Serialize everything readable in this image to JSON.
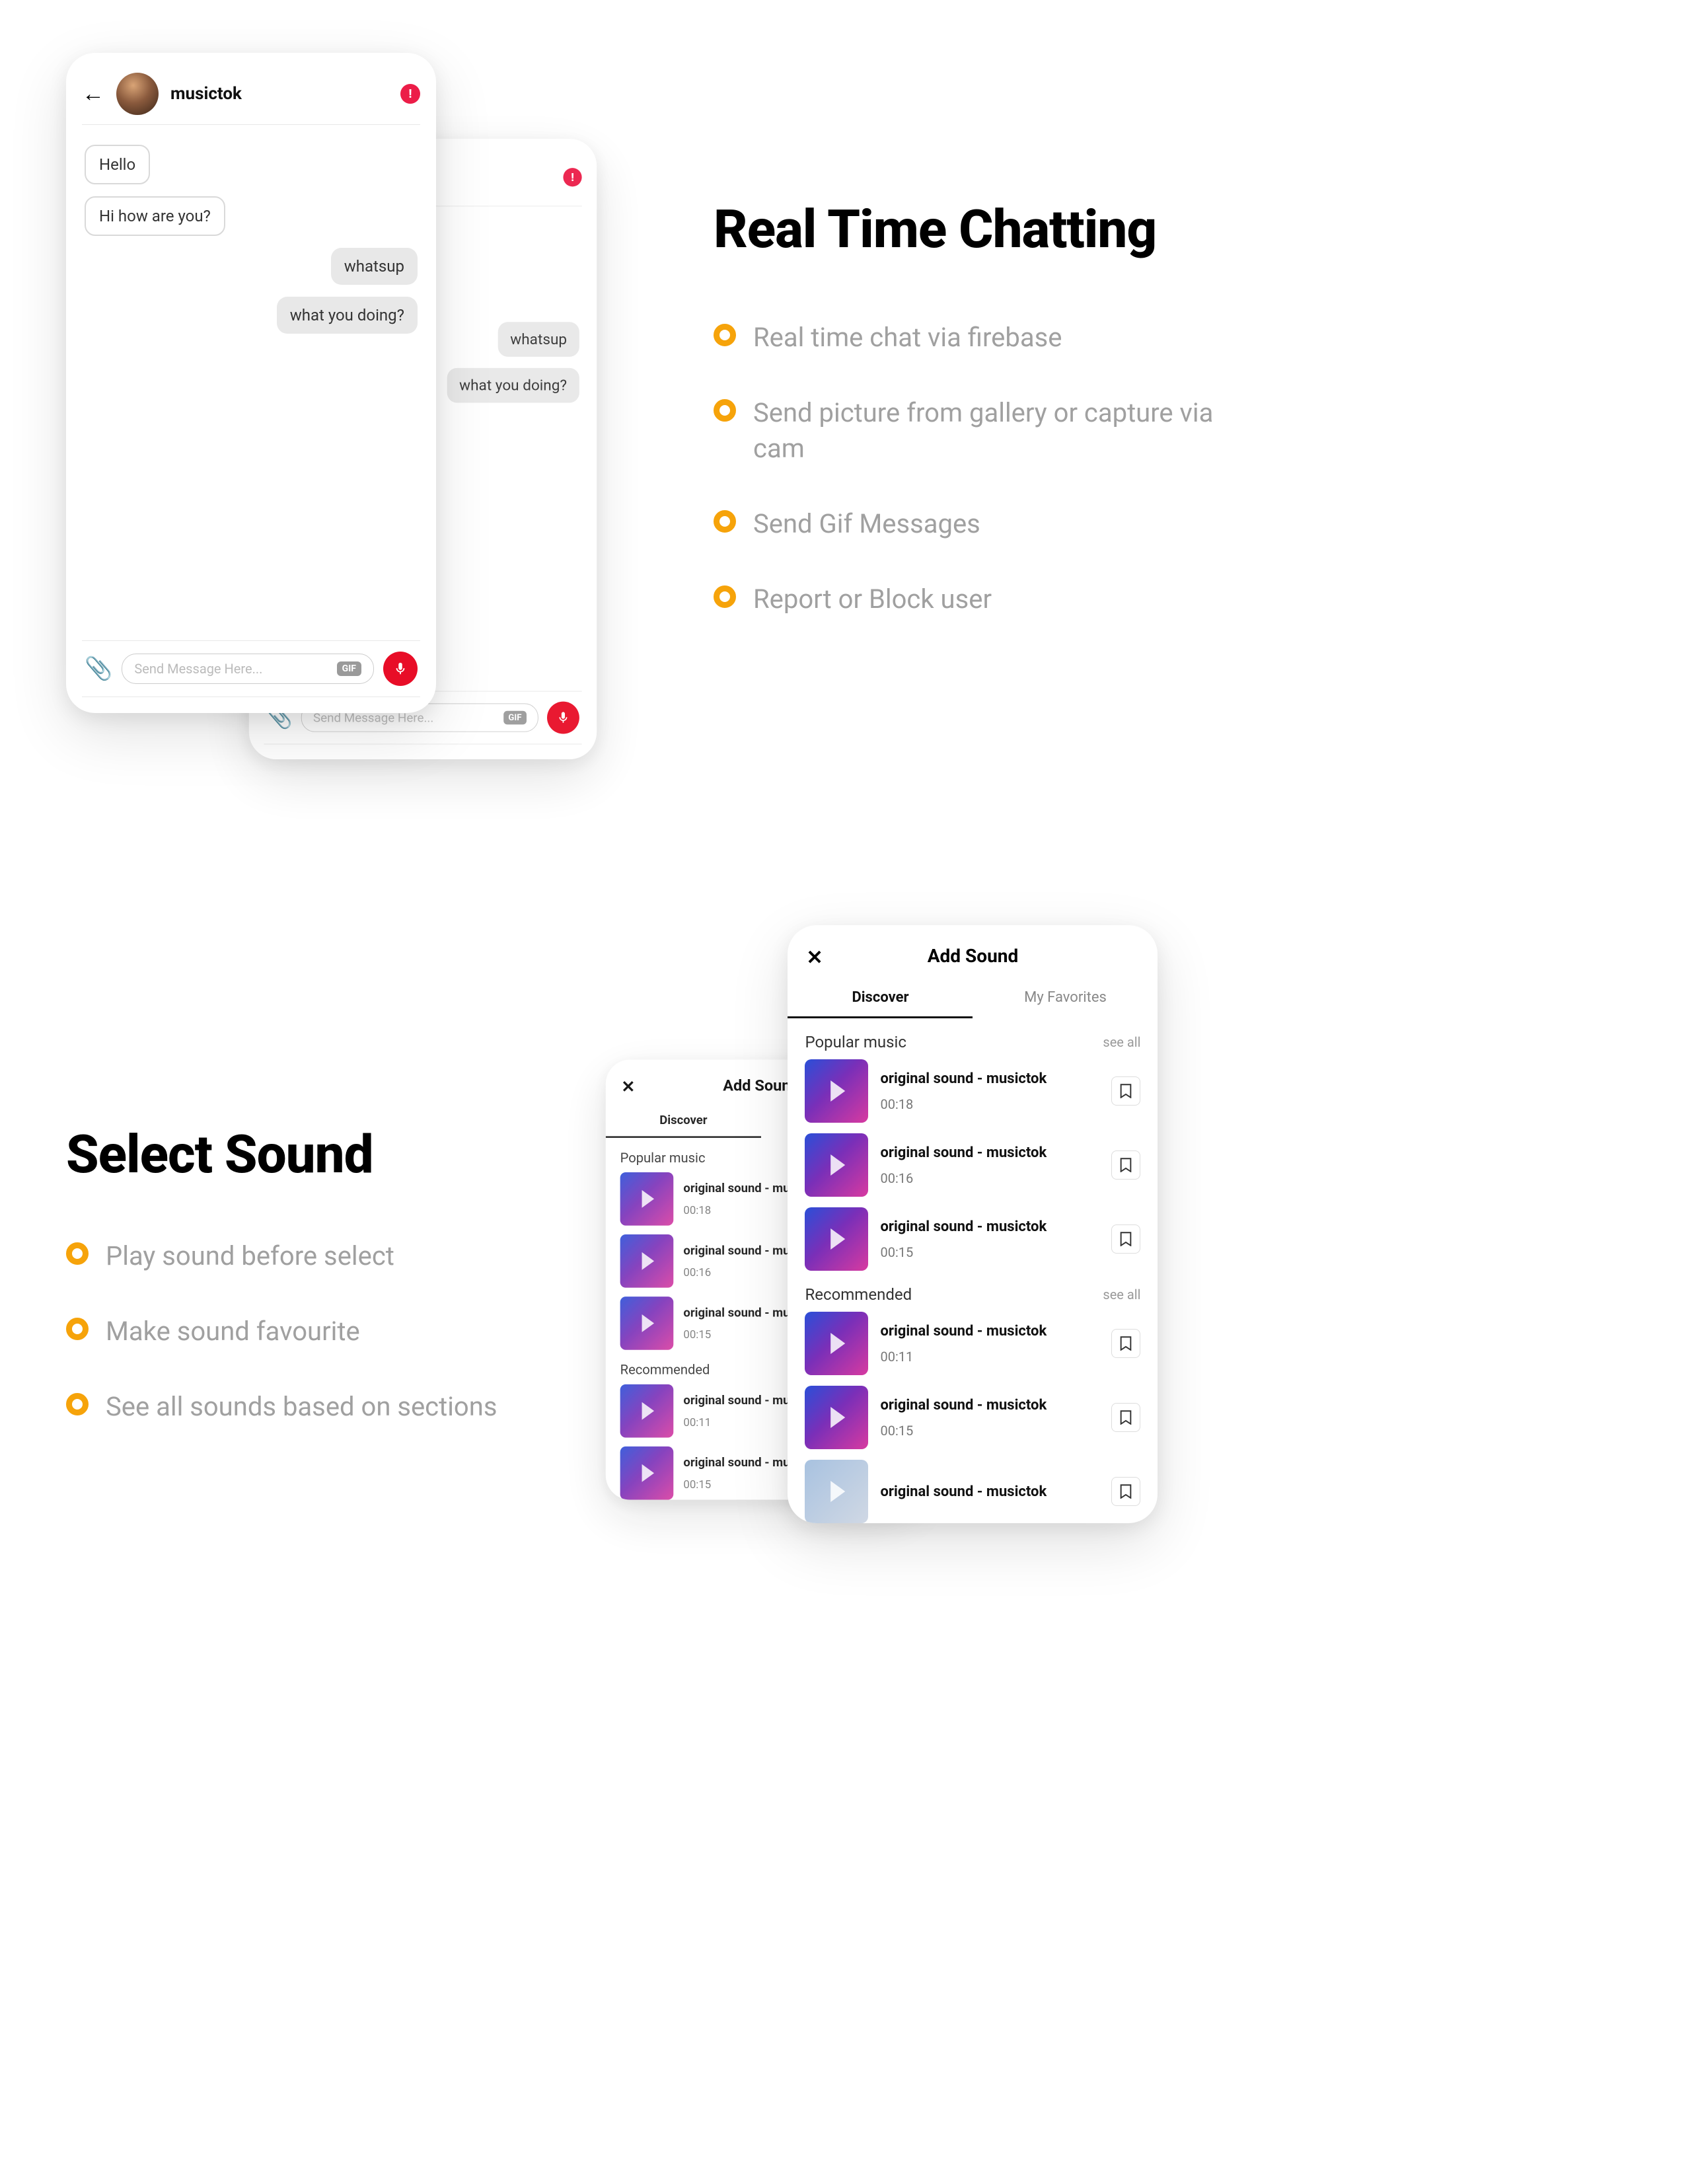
{
  "chat": {
    "username": "musictok",
    "messages_left": [
      "Hello",
      "Hi how are you?"
    ],
    "messages_right": [
      "whatsup",
      "what you doing?"
    ],
    "placeholder": "Send Message Here...",
    "gif_label": "GIF",
    "alert": "!"
  },
  "section1": {
    "title": "Real Time Chatting",
    "items": [
      "Real time chat via firebase",
      "Send picture from gallery or capture via cam",
      "Send Gif Messages",
      "Report or Block user"
    ]
  },
  "section2": {
    "title": "Select Sound",
    "items": [
      "Play sound before select",
      "Make sound favourite",
      "See all sounds based on sections"
    ]
  },
  "sound": {
    "header": "Add Sound",
    "tabs": {
      "discover": "Discover",
      "fav": "My Favorites"
    },
    "popular_label": "Popular music",
    "recommended_label": "Recommended",
    "see_all": "see all",
    "track_name": "original sound - musictok",
    "popular_durations": [
      "00:18",
      "00:16",
      "00:15"
    ],
    "recommended_durations": [
      "00:11",
      "00:15"
    ]
  }
}
